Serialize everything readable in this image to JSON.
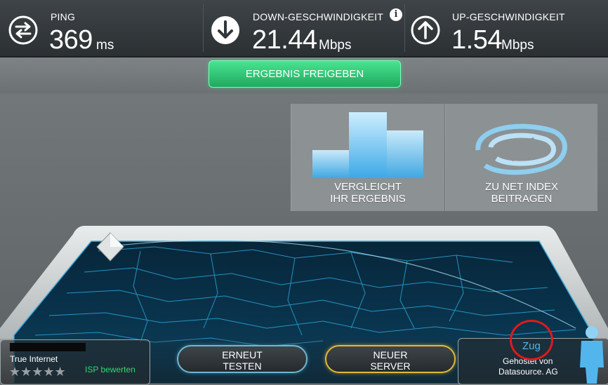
{
  "stats": {
    "ping": {
      "label": "PING",
      "value": "369",
      "unit": "ms",
      "icon": "ping-arrows-icon"
    },
    "download": {
      "label": "DOWN-GESCHWINDIGKEIT",
      "value": "21.44",
      "unit": "Mbps",
      "icon": "download-arrow-icon",
      "info": "i"
    },
    "upload": {
      "label": "UP-GESCHWINDIGKEIT",
      "value": "1.54",
      "unit": "Mbps",
      "icon": "upload-arrow-icon"
    }
  },
  "share": {
    "label": "ERGEBNIS FREIGEBEN"
  },
  "panels": {
    "compare": {
      "line1": "VERGLEICHT",
      "line2": "IHR ERGEBNIS",
      "icon": "bar-chart-icon"
    },
    "netindex": {
      "line1": "ZU NET INDEX",
      "line2": "BEITRAGEN",
      "icon": "net-index-icon"
    }
  },
  "isp": {
    "name": "True Internet",
    "rate_label": "ISP bewerten",
    "stars": "★★★★★",
    "rating": 0
  },
  "buttons": {
    "retest": {
      "line1": "ERNEUT",
      "line2": "TESTEN"
    },
    "new_server": {
      "line1": "NEUER",
      "line2": "SERVER"
    }
  },
  "host": {
    "city": "Zug",
    "line1": "Gehostet von",
    "line2": "Datasource. AG"
  },
  "colors": {
    "accent_green": "#2fd675",
    "accent_blue": "#52b6ec",
    "accent_gold": "#e2b837",
    "highlight_red": "#e01a1a"
  }
}
